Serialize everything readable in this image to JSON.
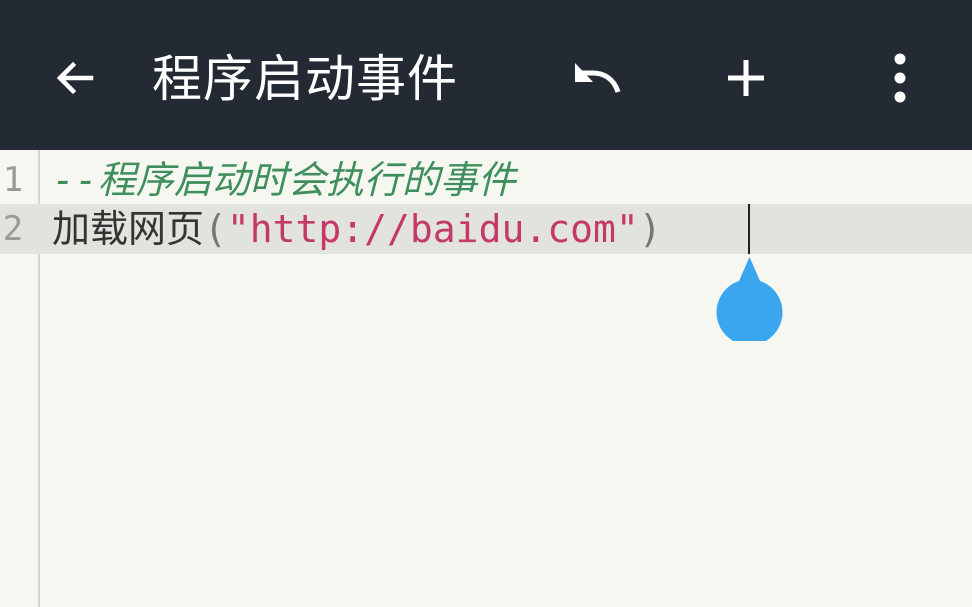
{
  "toolbar": {
    "title": "程序启动事件",
    "back_icon": "arrow-left-icon",
    "undo_icon": "undo-icon",
    "add_icon": "plus-icon",
    "more_icon": "more-vertical-icon",
    "background_color": "#232a34"
  },
  "editor": {
    "lines": [
      {
        "number": "1",
        "comment": "--程序启动时会执行的事件"
      },
      {
        "number": "2",
        "function_name": "加载网页",
        "open_paren": "(",
        "string_literal": "\"http://baidu.com\"",
        "close_paren": ")"
      }
    ],
    "current_line": "2",
    "colors": {
      "comment": "#3f8f5c",
      "string": "#c5396a",
      "current_line_bg": "#e3e3de",
      "cursor_handle": "#3aa6f0"
    },
    "cursor_handle_icon": "text-cursor-handle-icon"
  }
}
